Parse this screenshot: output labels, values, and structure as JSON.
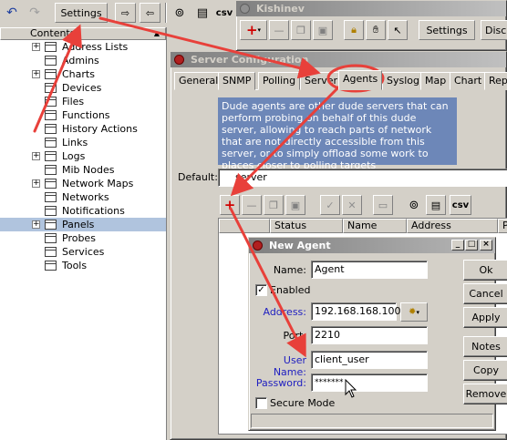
{
  "toolbar": {
    "settings_label": "Settings",
    "csv_label": "csv"
  },
  "tree": {
    "header": "Contents",
    "items": [
      {
        "label": "Address Lists",
        "expandable": true
      },
      {
        "label": "Admins",
        "expandable": false
      },
      {
        "label": "Charts",
        "expandable": true
      },
      {
        "label": "Devices",
        "expandable": false
      },
      {
        "label": "Files",
        "expandable": false
      },
      {
        "label": "Functions",
        "expandable": false
      },
      {
        "label": "History Actions",
        "expandable": false
      },
      {
        "label": "Links",
        "expandable": false
      },
      {
        "label": "Logs",
        "expandable": true
      },
      {
        "label": "Mib Nodes",
        "expandable": false
      },
      {
        "label": "Network Maps",
        "expandable": true
      },
      {
        "label": "Networks",
        "expandable": false
      },
      {
        "label": "Notifications",
        "expandable": false
      },
      {
        "label": "Panels",
        "expandable": true,
        "selected": true
      },
      {
        "label": "Probes",
        "expandable": false
      },
      {
        "label": "Services",
        "expandable": false
      },
      {
        "label": "Tools",
        "expandable": false
      }
    ]
  },
  "map_window": {
    "title": "Kishinev",
    "settings_label": "Settings",
    "disc_label": "Disc"
  },
  "server_config": {
    "title": "Server Configuration",
    "tabs": [
      "General",
      "SNMP",
      "Polling",
      "Server",
      "Agents",
      "Syslog",
      "Map",
      "Chart",
      "Repo"
    ],
    "active_tab": "Agents",
    "description": "Dude agents are other dude servers that can perform probing on behalf of this dude server, allowing to reach parts of network that are not directly accessible from this server, or to simply offload some work to places closer to polling targets",
    "default_label": "Default:",
    "default_value": "server",
    "csv_label": "csv",
    "columns": [
      "Status",
      "Name",
      "Address",
      "Po"
    ]
  },
  "new_agent": {
    "title": "New Agent",
    "name_label": "Name:",
    "name_value": "Agent",
    "enabled_label": "Enabled",
    "enabled_checked": true,
    "address_label": "Address:",
    "address_value": "192.168.168.100",
    "port_label": "Port:",
    "port_value": "2210",
    "username_label": "User Name:",
    "username_value": "client_user",
    "password_label": "Password:",
    "password_value": "*******",
    "secure_label": "Secure Mode",
    "secure_checked": false,
    "buttons": {
      "ok": "Ok",
      "cancel": "Cancel",
      "apply": "Apply",
      "notes": "Notes",
      "copy": "Copy",
      "remove": "Remove"
    }
  },
  "colors": {
    "annotation_arrow": "#e8403a",
    "selected_row": "#b0c4de"
  }
}
